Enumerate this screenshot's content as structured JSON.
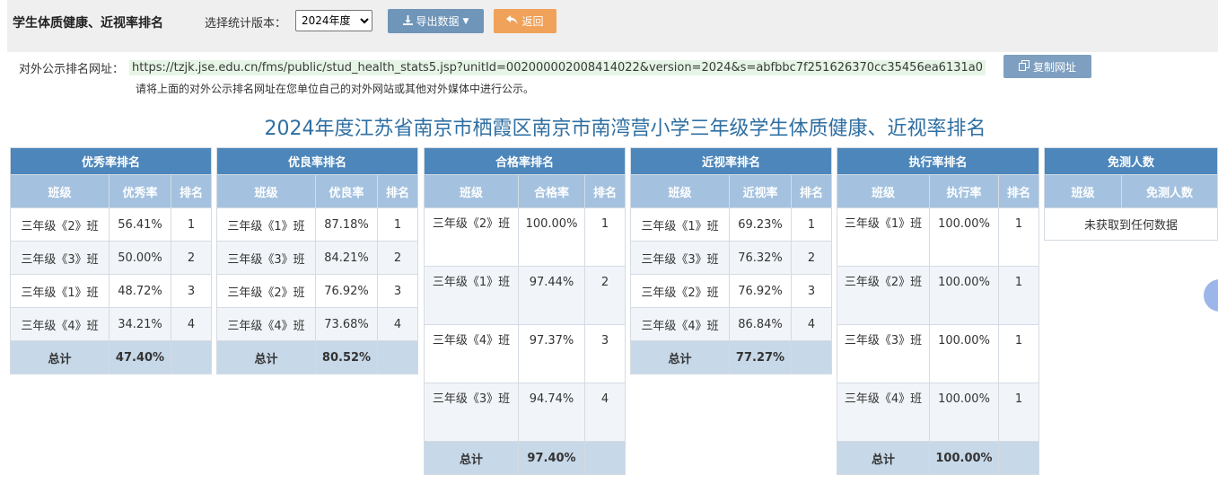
{
  "header": {
    "app_title": "学生体质健康、近视率排名",
    "version_label": "选择统计版本：",
    "version_selected": "2024年度",
    "export_label": "导出数据",
    "back_label": "返回"
  },
  "url_row": {
    "label": "对外公示排名网址：",
    "url": "https://tzjk.jse.edu.cn/fms/public/stud_health_stats5.jsp?unitId=002000002008414022&version=2024&s=abfbbc7f251626370cc35456ea6131a0",
    "copy_label": "复制网址",
    "notice": "请将上面的对外公示排名网址在您单位自己的对外网站或其他对外媒体中进行公示。"
  },
  "page_title": "2024年度江苏省南京市栖霞区南京市南湾营小学三年级学生体质健康、近视率排名",
  "tables": {
    "excellent": {
      "title": "优秀率排名",
      "cols": [
        "班级",
        "优秀率",
        "排名"
      ],
      "rows": [
        [
          "三年级《2》班",
          "56.41%",
          "1"
        ],
        [
          "三年级《3》班",
          "50.00%",
          "2"
        ],
        [
          "三年级《1》班",
          "48.72%",
          "3"
        ],
        [
          "三年级《4》班",
          "34.21%",
          "4"
        ]
      ],
      "total_label": "总计",
      "total_value": "47.40%"
    },
    "good": {
      "title": "优良率排名",
      "cols": [
        "班级",
        "优良率",
        "排名"
      ],
      "rows": [
        [
          "三年级《1》班",
          "87.18%",
          "1"
        ],
        [
          "三年级《3》班",
          "84.21%",
          "2"
        ],
        [
          "三年级《2》班",
          "76.92%",
          "3"
        ],
        [
          "三年级《4》班",
          "73.68%",
          "4"
        ]
      ],
      "total_label": "总计",
      "total_value": "80.52%"
    },
    "pass": {
      "title": "合格率排名",
      "cols": [
        "班级",
        "合格率",
        "排名"
      ],
      "rows": [
        [
          "三年级《2》班",
          "100.00%",
          "1"
        ],
        [
          "三年级《1》班",
          "97.44%",
          "2"
        ],
        [
          "三年级《4》班",
          "97.37%",
          "3"
        ],
        [
          "三年级《3》班",
          "94.74%",
          "4"
        ]
      ],
      "total_label": "总计",
      "total_value": "97.40%"
    },
    "myopia": {
      "title": "近视率排名",
      "cols": [
        "班级",
        "近视率",
        "排名"
      ],
      "rows": [
        [
          "三年级《1》班",
          "69.23%",
          "1"
        ],
        [
          "三年级《3》班",
          "76.32%",
          "2"
        ],
        [
          "三年级《2》班",
          "76.92%",
          "3"
        ],
        [
          "三年级《4》班",
          "86.84%",
          "4"
        ]
      ],
      "total_label": "总计",
      "total_value": "77.27%"
    },
    "execution": {
      "title": "执行率排名",
      "cols": [
        "班级",
        "执行率",
        "排名"
      ],
      "rows": [
        [
          "三年级《1》班",
          "100.00%",
          "1"
        ],
        [
          "三年级《2》班",
          "100.00%",
          "1"
        ],
        [
          "三年级《3》班",
          "100.00%",
          "1"
        ],
        [
          "三年级《4》班",
          "100.00%",
          "1"
        ]
      ],
      "total_label": "总计",
      "total_value": "100.00%"
    },
    "exempt": {
      "title": "免测人数",
      "cols": [
        "班级",
        "免测人数"
      ],
      "empty_text": "未获取到任何数据"
    }
  },
  "colors": {
    "header_blue": "#4d86ba",
    "subheader_blue": "#a4c2df",
    "total_row": "#c7d8e8",
    "title_blue": "#2f6fa2",
    "back_orange": "#f0a25a"
  }
}
